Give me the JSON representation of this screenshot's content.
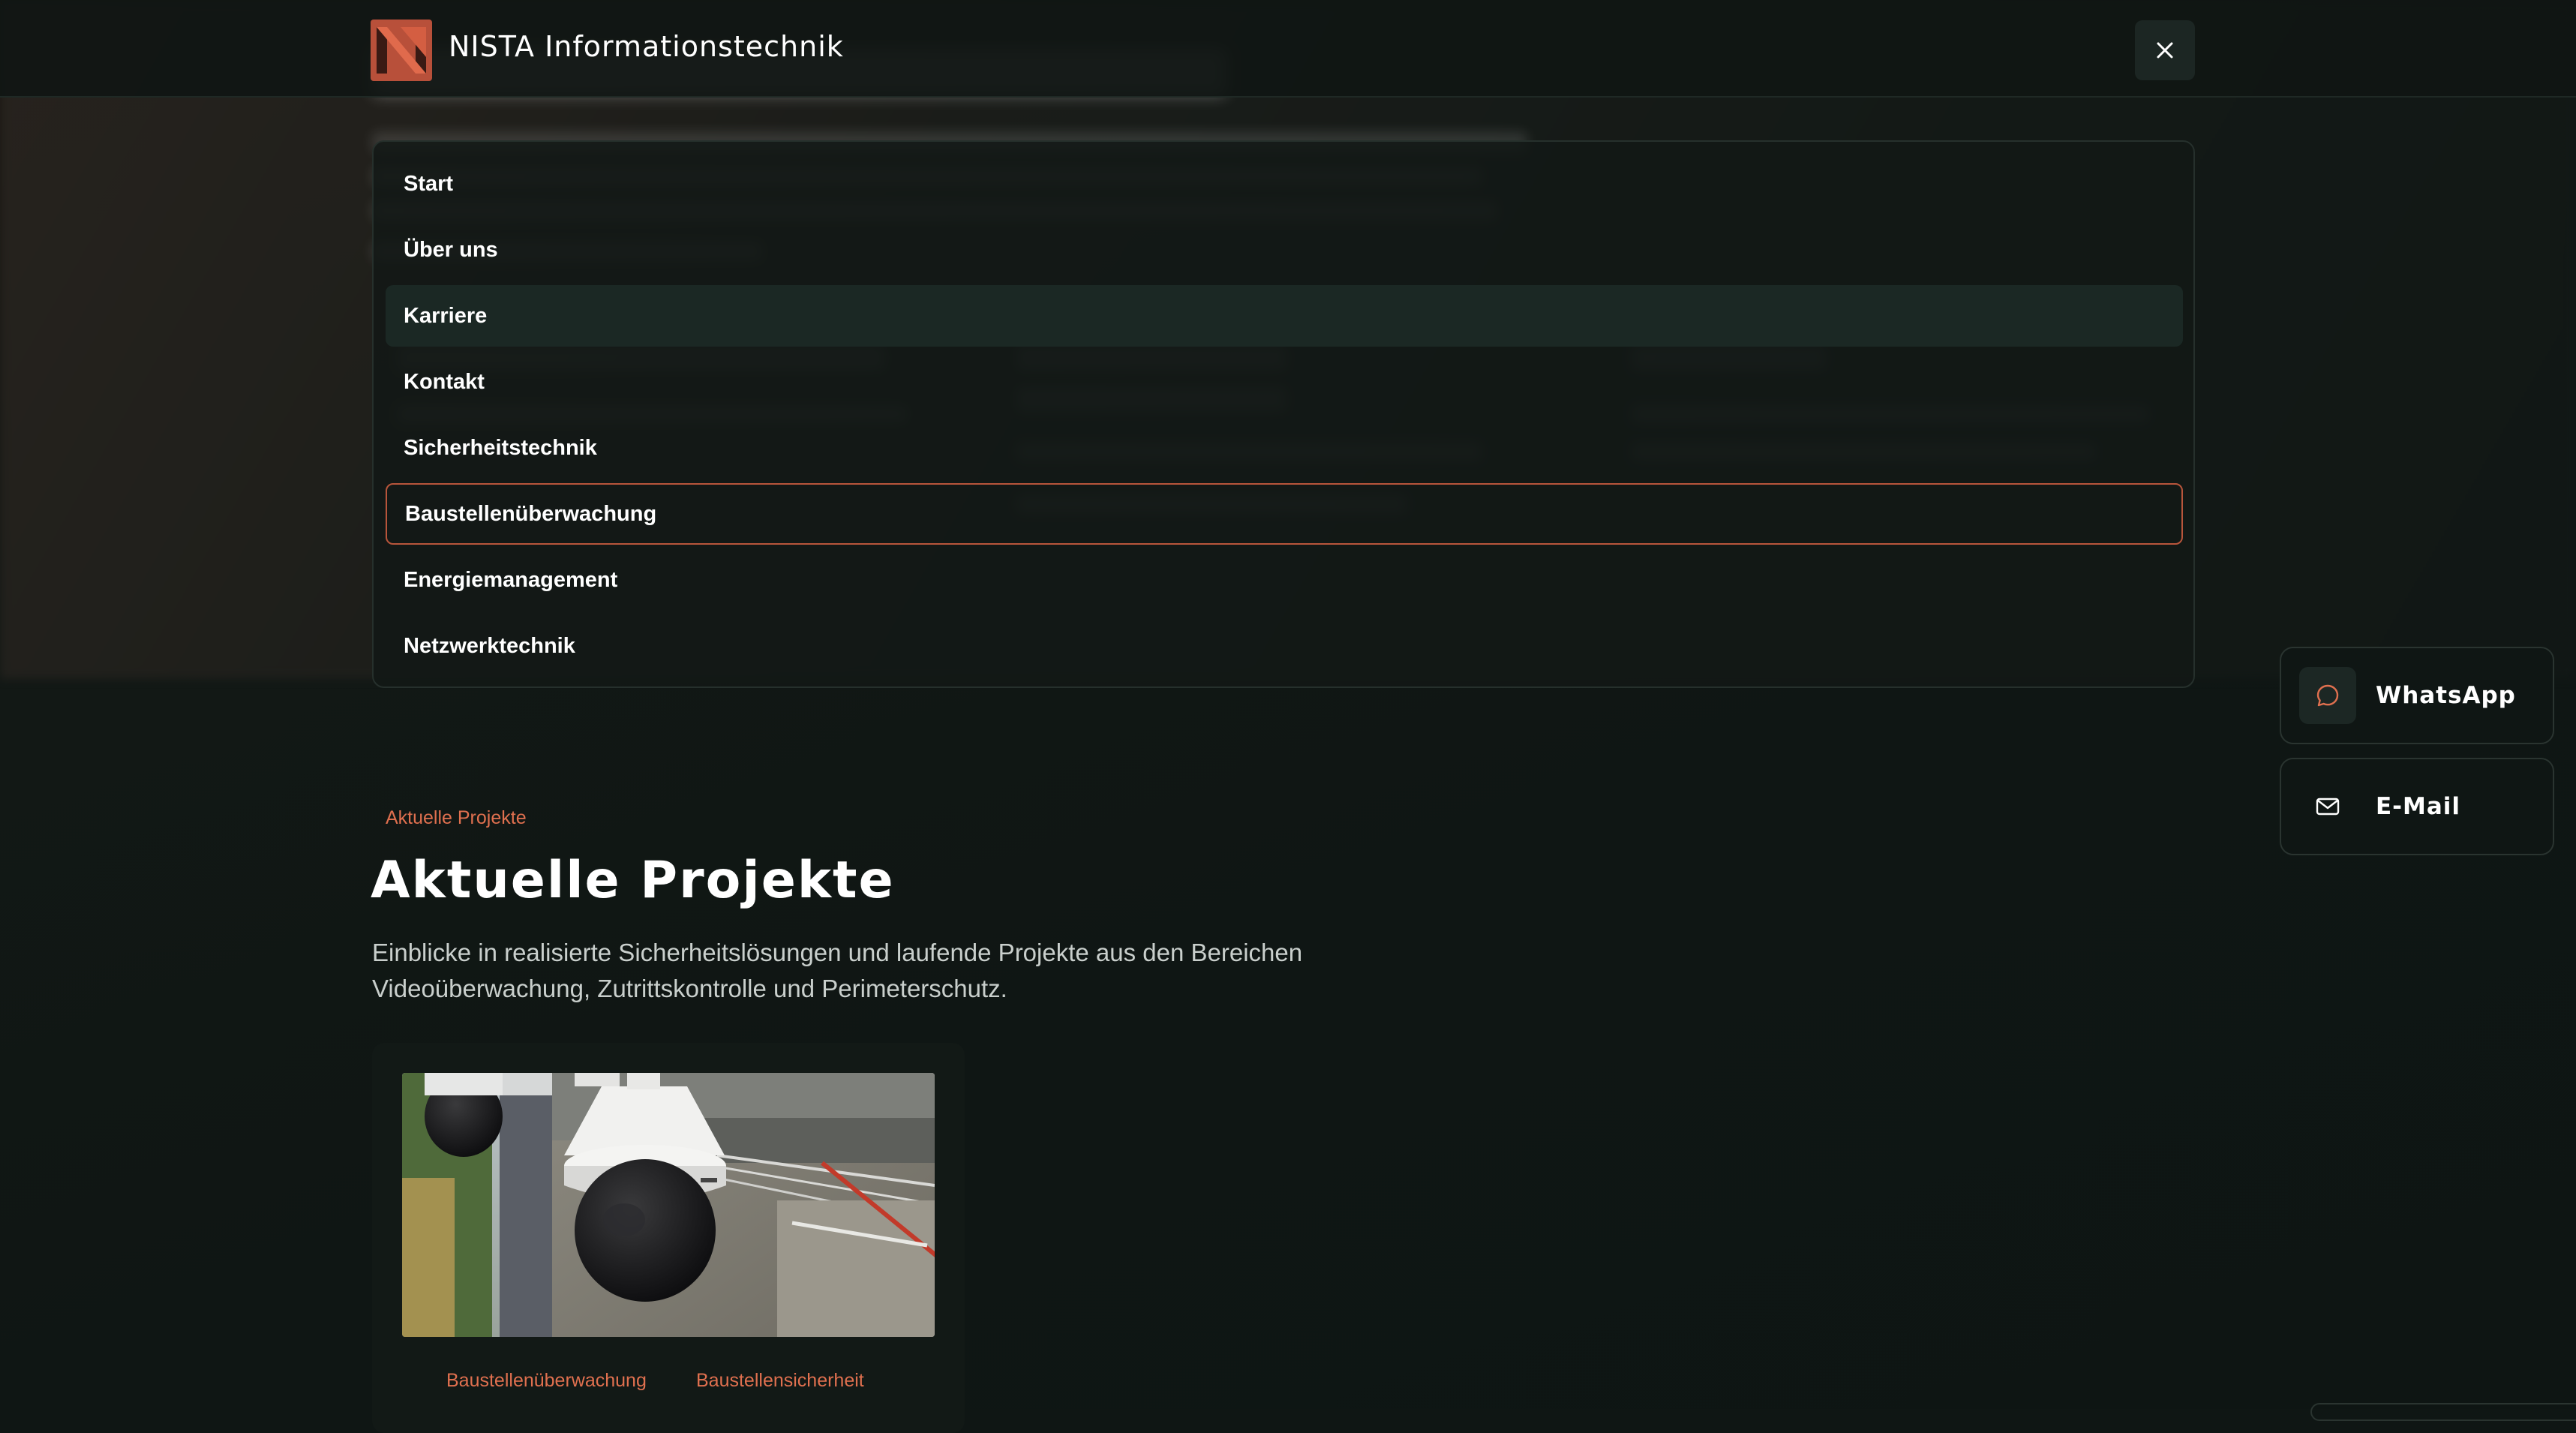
{
  "header": {
    "brand": "NISTA Informationstechnik"
  },
  "menu": {
    "items": [
      {
        "label": "Start"
      },
      {
        "label": "Über uns"
      },
      {
        "label": "Karriere"
      },
      {
        "label": "Kontakt"
      },
      {
        "label": "Sicherheitstechnik"
      },
      {
        "label": "Baustellenüberwachung"
      },
      {
        "label": "Energiemanagement"
      },
      {
        "label": "Netzwerktechnik"
      }
    ]
  },
  "contact": {
    "whatsapp_label": "WhatsApp",
    "email_label": "E-Mail"
  },
  "projects": {
    "badge": "Aktuelle Projekte",
    "title": "Aktuelle Projekte",
    "description": "Einblicke in realisierte Sicherheitslösungen und laufende Projekte aus den Bereichen Videoüberwachung, Zutrittskontrolle und Perimeterschutz.",
    "cards": [
      {
        "tags": [
          "Baustellenüberwachung",
          "Baustellensicherheit"
        ]
      }
    ]
  },
  "colors": {
    "background": "#0f1614",
    "accent": "#e0704f",
    "focus_border": "#b8553b",
    "hover_bg": "#1b2824"
  },
  "icons": {
    "logo": "nista-logo-icon",
    "close": "close-icon",
    "whatsapp": "chat-bubble-icon",
    "email": "mail-icon"
  }
}
